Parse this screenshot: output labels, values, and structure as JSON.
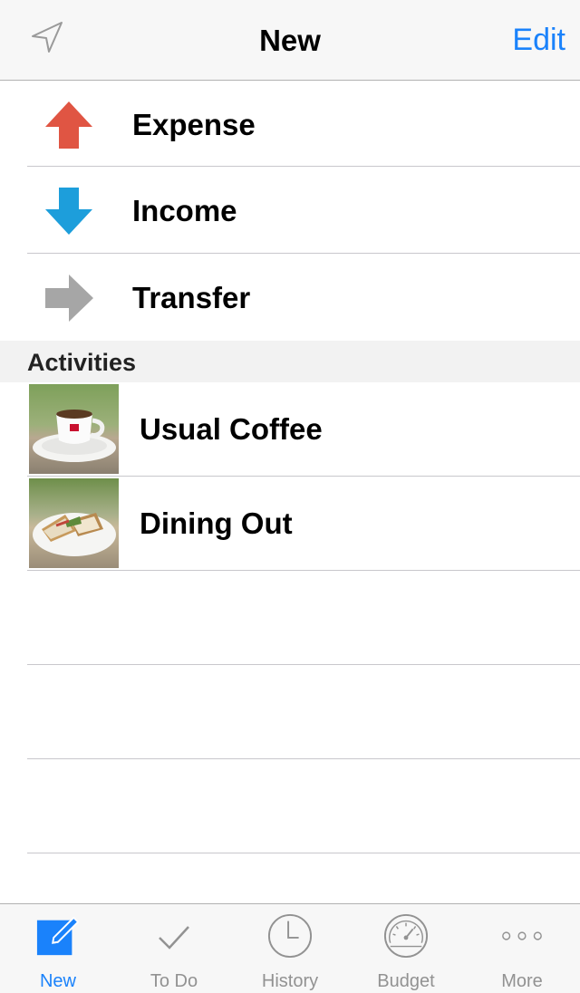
{
  "navbar": {
    "title": "New",
    "edit_label": "Edit",
    "location_icon": "location-arrow-icon"
  },
  "entries": [
    {
      "label": "Expense",
      "icon": "arrow-up-icon",
      "color": "#e05543"
    },
    {
      "label": "Income",
      "icon": "arrow-down-icon",
      "color": "#1d9edb"
    },
    {
      "label": "Transfer",
      "icon": "arrow-right-icon",
      "color": "#a6a6a6"
    }
  ],
  "activities": {
    "header": "Activities",
    "items": [
      {
        "label": "Usual Coffee",
        "thumbnail": "coffee-cup-photo"
      },
      {
        "label": "Dining Out",
        "thumbnail": "sandwich-plate-photo"
      }
    ]
  },
  "tabbar": {
    "tabs": [
      {
        "label": "New",
        "icon": "compose-icon",
        "active": true
      },
      {
        "label": "To Do",
        "icon": "checkmark-icon",
        "active": false
      },
      {
        "label": "History",
        "icon": "clock-icon",
        "active": false
      },
      {
        "label": "Budget",
        "icon": "speedometer-icon",
        "active": false
      },
      {
        "label": "More",
        "icon": "more-dots-icon",
        "active": false
      }
    ]
  },
  "colors": {
    "accent": "#1a82fb",
    "inactive_tab": "#929292",
    "separator": "#c8c7cc"
  }
}
